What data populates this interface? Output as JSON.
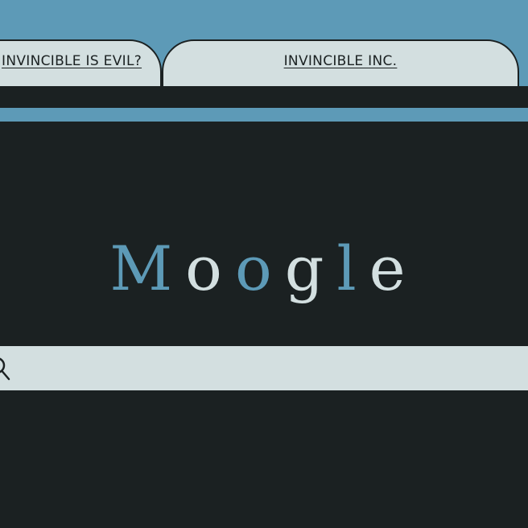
{
  "tabs": [
    {
      "label": "INVINCIBLE IS EVIL?"
    },
    {
      "label": "INVINCIBLE INC."
    }
  ],
  "logo": {
    "letters": [
      {
        "char": "M",
        "color": "#5d9ab7"
      },
      {
        "char": "o",
        "color": "#d3dfe0"
      },
      {
        "char": "o",
        "color": "#5d9ab7"
      },
      {
        "char": "g",
        "color": "#d3dfe0"
      },
      {
        "char": "l",
        "color": "#5d9ab7"
      },
      {
        "char": "e",
        "color": "#d3dfe0"
      }
    ]
  },
  "search": {
    "icon": "search-icon",
    "value": "",
    "placeholder": ""
  },
  "colors": {
    "background": "#1b2122",
    "accent": "#5d9ab7",
    "light": "#d3dfe0"
  }
}
